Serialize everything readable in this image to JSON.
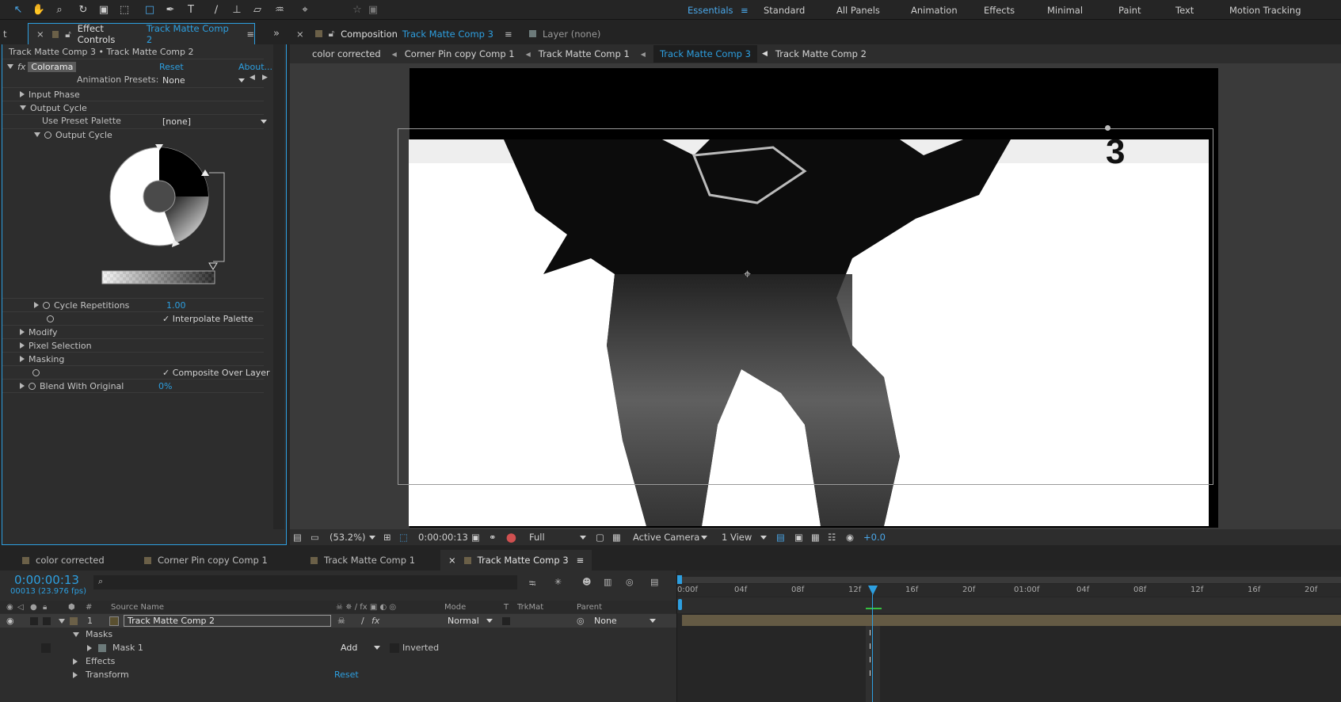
{
  "toolbar": {
    "tools": [
      "selection-tool",
      "hand-tool",
      "zoom-tool",
      "rotation-tool",
      "camera-tool",
      "pan-behind-tool",
      "rectangle-tool",
      "pen-tool",
      "type-tool",
      "brush-tool",
      "clone-stamp-tool",
      "eraser-tool",
      "roto-brush-tool",
      "puppet-pin-tool"
    ],
    "workspaces": [
      "Essentials",
      "Standard",
      "All Panels",
      "Animation",
      "Effects",
      "Minimal",
      "Paint",
      "Text",
      "Motion Tracking"
    ],
    "active_workspace": "Essentials"
  },
  "effect_controls": {
    "tab_label": "Effect Controls",
    "tab_comp": "Track Matte Comp 2",
    "left_tab_stub": "t",
    "breadcrumb": "Track Matte Comp 3 • Track Matte Comp 2",
    "effect_name": "Colorama",
    "reset": "Reset",
    "about": "About...",
    "animation_presets_label": "Animation Presets:",
    "animation_presets_value": "None",
    "input_phase": "Input Phase",
    "output_cycle": "Output Cycle",
    "use_preset_palette_label": "Use Preset Palette",
    "use_preset_palette_value": "[none]",
    "output_cycle_sub": "Output Cycle",
    "cycle_repetitions_label": "Cycle Repetitions",
    "cycle_repetitions_value": "1.00",
    "interpolate_palette": "Interpolate Palette",
    "modify": "Modify",
    "pixel_selection": "Pixel Selection",
    "masking": "Masking",
    "composite_over_layer": "Composite Over Layer",
    "blend_with_original_label": "Blend With Original",
    "blend_with_original_value": "0%"
  },
  "composition": {
    "tab_label": "Composition",
    "tab_comp": "Track Matte Comp 3",
    "layer_tab": "Layer (none)",
    "flow": [
      "color corrected",
      "Corner Pin copy  Comp 1",
      "Track Matte Comp 1",
      "Track Matte Comp 3",
      "Track Matte Comp 2"
    ],
    "active_flow": "Track Matte Comp 3",
    "footer": {
      "zoom": "(53.2%)",
      "timecode": "0:00:00:13",
      "resolution": "Full",
      "camera": "Active Camera",
      "views": "1 View",
      "exposure": "+0.0"
    }
  },
  "timeline": {
    "tabs": [
      "color corrected",
      "Corner Pin copy  Comp 1",
      "Track Matte Comp 1",
      "Track Matte Comp 3"
    ],
    "active_tab": "Track Matte Comp 3",
    "timecode": "0:00:00:13",
    "frame_info": "00013 (23.976 fps)",
    "columns": {
      "number": "#",
      "source_name": "Source Name",
      "mode": "Mode",
      "t": "T",
      "trkmat": "TrkMat",
      "parent": "Parent"
    },
    "layer": {
      "number": "1",
      "name": "Track Matte Comp 2",
      "mode": "Normal",
      "parent": "None"
    },
    "masks_label": "Masks",
    "mask1_label": "Mask 1",
    "mask1_mode": "Add",
    "mask1_inverted": "Inverted",
    "effects_label": "Effects",
    "transform_label": "Transform",
    "transform_reset": "Reset",
    "ruler": [
      "0:00f",
      "04f",
      "08f",
      "12f",
      "16f",
      "20f",
      "01:00f",
      "04f",
      "08f",
      "12f",
      "16f",
      "20f"
    ],
    "current_frame": 13
  },
  "colors": {
    "accent": "#2d9fe0",
    "panel": "#2d2d2d",
    "bg": "#232323",
    "layer_bar": "#6b6048"
  }
}
